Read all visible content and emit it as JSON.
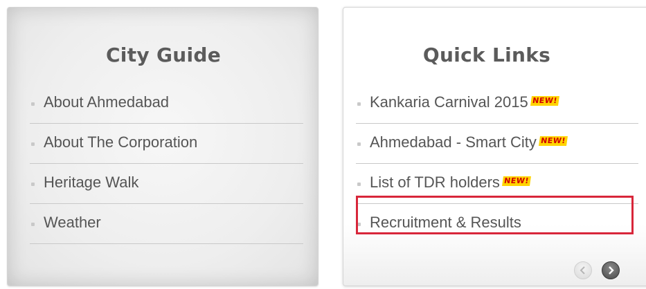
{
  "city_guide": {
    "title": "City Guide",
    "items": [
      {
        "label": "About Ahmedabad"
      },
      {
        "label": "About The Corporation"
      },
      {
        "label": "Heritage Walk"
      },
      {
        "label": "Weather"
      }
    ]
  },
  "quick_links": {
    "title": "Quick Links",
    "new_badge": "NEW!",
    "items": [
      {
        "label": "Kankaria Carnival 2015",
        "is_new": true
      },
      {
        "label": "Ahmedabad - Smart City",
        "is_new": true
      },
      {
        "label": "List of TDR holders",
        "is_new": true
      },
      {
        "label": "Recruitment & Results",
        "is_new": false
      }
    ],
    "highlighted_item": "Recruitment & Results"
  },
  "carousel": {
    "prev_icon": "chevron-left-icon",
    "next_icon": "chevron-right-icon"
  },
  "colors": {
    "highlight": "#d8263a",
    "badge_bg": "#ffd400",
    "badge_text": "#d10000"
  }
}
